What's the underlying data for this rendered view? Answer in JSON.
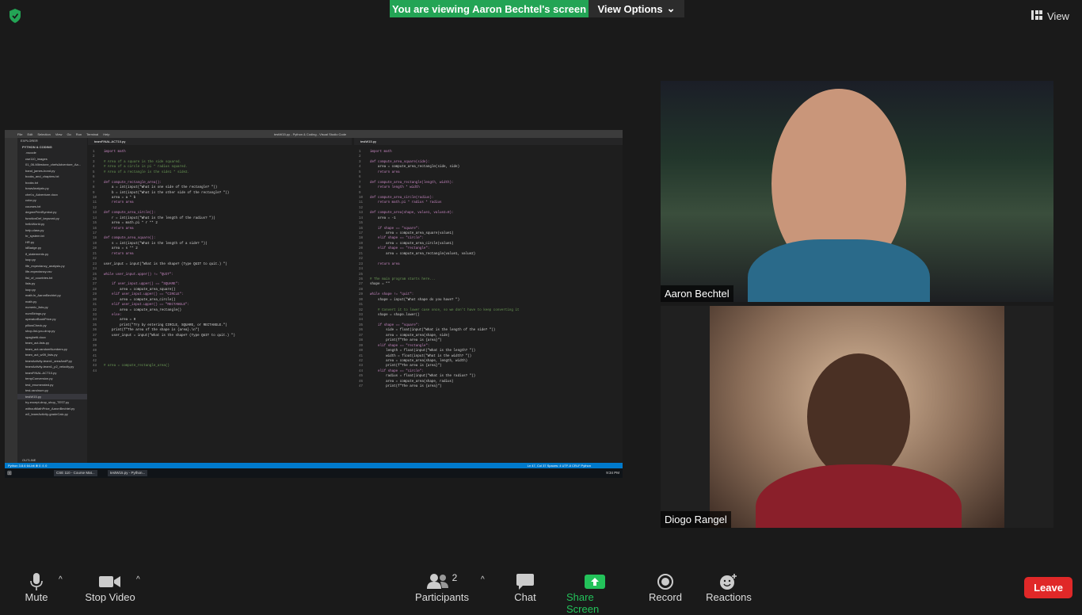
{
  "banner": {
    "viewing": "You are viewing Aaron Bechtel's screen",
    "view_options": "View Options"
  },
  "top_right": {
    "view_label": "View"
  },
  "vscode": {
    "title": "testW15.py - Python & Coding - Visual Studio Code",
    "menu": [
      "File",
      "Edit",
      "Selection",
      "View",
      "Go",
      "Run",
      "Terminal",
      "Help"
    ],
    "explorer_header": "EXPLORER",
    "folder": "PYTHON & CODING",
    "files": [
      ".vscode",
      "cse110_images",
      "01_06-Milestone_chefsAdventure_Aa...",
      "band_james-bond.py",
      "books_and_chapters.txt",
      "books.txt",
      "bowsAnalysis.py",
      "chef-s_Adventure.docx",
      "color.py",
      "courses.txt",
      "degreePrintSymbol.py",
      "functionDef_keyword.py",
      "helloWorld.py",
      "help-class.py",
      "hr_system.txt",
      "HR.py",
      "idBadge.py",
      "if_statements.py",
      "loop.py",
      "life_expectancy_analysis.py",
      "life-expectancy.csv",
      "list_of_countries.txt",
      "lists.py",
      "loop.py",
      "math.ln_AaronBechtel.py",
      "math.py",
      "numeric_lists.py",
      "numStrings.py",
      "operatorBookPrice.py",
      "pillowCheck.py",
      "shop-list-you-drop.py",
      "spaghetti.docx",
      "team_act-lists.py",
      "team_act-randomNumbers.py",
      "team_act_w09_lists.py",
      "teamActivity-team1_areaAndP.py",
      "teamActivity-team1_p2_velocity.py",
      "teamFINAL-ACT10.py",
      "tempConversion.py",
      "test_enumerated.py",
      "test-randnum.py",
      "testW15.py",
      "try-except-drop_shop_TEST.py",
      "withoutMathPrice_AaronBechtel.py",
      "w3_teamActivity-gradeCalc.py"
    ],
    "outline": "OUTLINE",
    "tab1": "teamFINAL-ACT10.py",
    "tab2": "testW15.py",
    "code1": [
      "import math",
      "",
      "# Area of a square is the side squared.",
      "# Area of a circle is pi * radius squared.",
      "# Area of a rectangle is the side1 * side2.",
      "",
      "def compute_rectangle_area():",
      "    a = int(input(\"What is one side of the rectangle? \"))",
      "    b = int(input(\"What is the other side of the rectangle? \"))",
      "    area = a * b",
      "    return area",
      "",
      "def compute_area_circle():",
      "    r = int(input(\"What is the length of the radius? \"))",
      "    area = math.pi * r ** 2",
      "    return area",
      "",
      "def compute_area_square():",
      "    s = int(input(\"What is the length of a side? \"))",
      "    area = s ** 2",
      "    return area",
      "",
      "user_input = input(\"What is the shape? (Type QUIT to quit.) \")",
      "",
      "while user_input.upper() != \"QUIT\":",
      "",
      "    if user_input.upper() == \"SQUARE\":",
      "        area = compute_area_square()",
      "    elif user_input.upper() == \"CIRCLE\":",
      "        area = compute_area_circle()",
      "    elif user_input.upper() == \"RECTANGLE\":",
      "        area = compute_area_rectangle()",
      "    else:",
      "        area = 0",
      "        print(\"Try by entering CIRCLE, SQUARE, or RECTANGLE.\")",
      "    print(f\"The area of the shape is {area}.\\n\")",
      "    user_input = input(\"What is the shape? (Type QUIT to quit.) \")",
      "",
      "",
      "",
      "",
      "",
      "# area = compute_rectangle_area()",
      ""
    ],
    "code2": [
      "import math",
      "",
      "def compute_area_square(side):",
      "    area = compute_area_rectangle(side, side)",
      "    return area",
      "",
      "def compute_area_rectangle(length, width):",
      "    return length * width",
      "",
      "def compute_area_circle(radius):",
      "    return math.pi * radius * radius",
      "",
      "def compute_area(shape, value1, value2=0):",
      "    area = -1",
      "",
      "    if shape == \"square\":",
      "        area = compute_area_square(value1)",
      "    elif shape == \"circle\":",
      "        area = compute_area_circle(value1)",
      "    elif shape == \"rectangle\":",
      "        area = compute_area_rectangle(value1, value2)",
      "",
      "    return area",
      "",
      "",
      "# The main program starts here...",
      "shape = \"\"",
      "",
      "while shape != \"quit\":",
      "    shape = input(\"What shape do you have? \")",
      "",
      "    # Convert it to lower case once, so we don't have to keep converting it",
      "    shape = shape.lower()",
      "",
      "    if shape == \"square\":",
      "        side = float(input(\"What is the length of the side? \"))",
      "        area = compute_area(shape, side)",
      "        print(f\"The area is {area}\")",
      "    elif shape == \"rectangle\":",
      "        length = float(input(\"What is the length? \"))",
      "        width = float(input(\"What is the width? \"))",
      "        area = compute_area(shape, length, width)",
      "        print(f\"The area is {area}\")",
      "    elif shape == \"circle\":",
      "        radius = float(input(\"What is the radius? \"))",
      "        area = compute_area(shape, radius)",
      "        print(f\"The area is {area}\")"
    ],
    "status_left": "Python 3.8.6 64-bit   ⊗ 0 ⚠ 0",
    "status_right": "Ln 47, Col 37   Spaces: 4   UTF-8   CRLF   Python",
    "taskbar_items": [
      "CSE 110 - Course Mat...",
      "testW15.py - Python..."
    ],
    "clock": "9:34 PM"
  },
  "participants": [
    {
      "name": "Aaron Bechtel"
    },
    {
      "name": "Diogo Rangel"
    }
  ],
  "controls": {
    "mute": "Mute",
    "video": "Stop Video",
    "participants": "Participants",
    "participants_count": "2",
    "chat": "Chat",
    "share": "Share Screen",
    "record": "Record",
    "reactions": "Reactions",
    "leave": "Leave"
  },
  "colors": {
    "share_green": "#23a455",
    "leave_red": "#e02828",
    "vscode_blue": "#007acc"
  }
}
